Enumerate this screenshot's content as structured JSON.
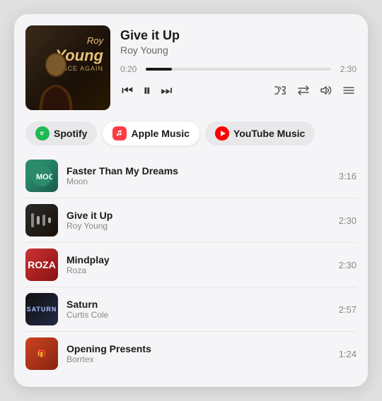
{
  "nowPlaying": {
    "title": "Give it Up",
    "artist": "Roy Young",
    "albumArtist": "Roy Young",
    "albumTitle": "Once Again",
    "currentTime": "0:20",
    "totalTime": "2:30",
    "progressPercent": 14
  },
  "controls": {
    "rewind": "⏮",
    "pause": "⏸",
    "forward": "⏭",
    "shuffle": "⇄",
    "repeat": "↻",
    "volume": "🔊",
    "list": "≡"
  },
  "serviceTabs": [
    {
      "id": "spotify",
      "label": "Spotify",
      "icon": "spotify",
      "active": false
    },
    {
      "id": "apple",
      "label": "Apple Music",
      "icon": "apple",
      "active": true
    },
    {
      "id": "youtube",
      "label": "YouTube Music",
      "icon": "youtube",
      "active": false
    }
  ],
  "tracks": [
    {
      "id": 1,
      "title": "Faster Than My Dreams",
      "artist": "Moon",
      "duration": "3:16",
      "thumb": "moon"
    },
    {
      "id": 2,
      "title": "Give it Up",
      "artist": "Roy Young",
      "duration": "2:30",
      "thumb": "giveitup"
    },
    {
      "id": 3,
      "title": "Mindplay",
      "artist": "Roza",
      "duration": "2:30",
      "thumb": "roza"
    },
    {
      "id": 4,
      "title": "Saturn",
      "artist": "Curtis Cole",
      "duration": "2:57",
      "thumb": "saturn"
    },
    {
      "id": 5,
      "title": "Opening Presents",
      "artist": "Borrtex",
      "duration": "1:24",
      "thumb": "opening"
    }
  ]
}
